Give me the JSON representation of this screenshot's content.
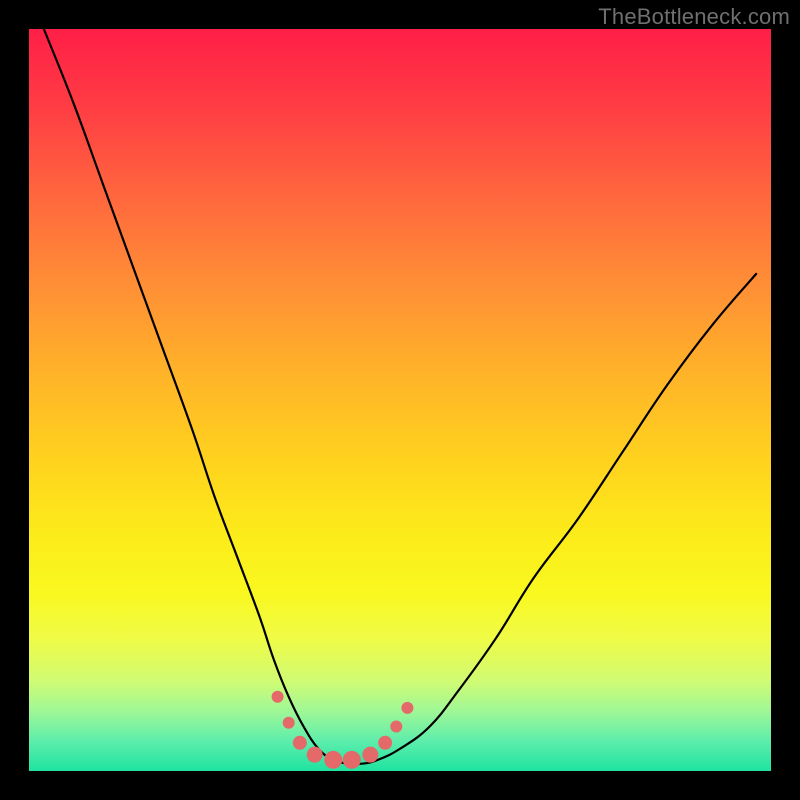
{
  "watermark": "TheBottleneck.com",
  "colors": {
    "page_bg": "#000000",
    "curve_stroke": "#000000",
    "marker_fill": "#e46a6a",
    "marker_stroke": "#e46a6a",
    "gradient_stops": [
      "#ff1f47",
      "#ff3b44",
      "#ff653e",
      "#ff8d36",
      "#ffb229",
      "#ffd21e",
      "#fceb1a",
      "#f9f81f",
      "#f0fb45",
      "#cffb74",
      "#9ef797",
      "#5dedab",
      "#1fe3a0"
    ]
  },
  "chart_data": {
    "type": "line",
    "title": "",
    "xlabel": "",
    "ylabel": "",
    "xlim": [
      0,
      100
    ],
    "ylim": [
      0,
      100
    ],
    "grid": false,
    "legend": false,
    "annotations": [
      "TheBottleneck.com"
    ],
    "series": [
      {
        "name": "bottleneck-curve",
        "x": [
          2,
          6,
          10,
          14,
          18,
          22,
          25,
          28,
          31,
          33,
          35,
          37,
          39,
          41,
          43,
          45,
          47,
          50,
          54,
          58,
          63,
          68,
          74,
          80,
          86,
          92,
          98
        ],
        "y": [
          100,
          90,
          79,
          68,
          57,
          46,
          37,
          29,
          21,
          15,
          10,
          6,
          3,
          1.5,
          1,
          1,
          1.5,
          3,
          6,
          11,
          18,
          26,
          34,
          43,
          52,
          60,
          67
        ]
      }
    ],
    "markers": {
      "name": "highlight-dots",
      "x": [
        33.5,
        35,
        36.5,
        38.5,
        41,
        43.5,
        46,
        48,
        49.5,
        51
      ],
      "y": [
        10,
        6.5,
        3.8,
        2.2,
        1.5,
        1.5,
        2.2,
        3.8,
        6.0,
        8.5
      ],
      "size": [
        6,
        6,
        7,
        8,
        9,
        9,
        8,
        7,
        6,
        6
      ]
    }
  }
}
